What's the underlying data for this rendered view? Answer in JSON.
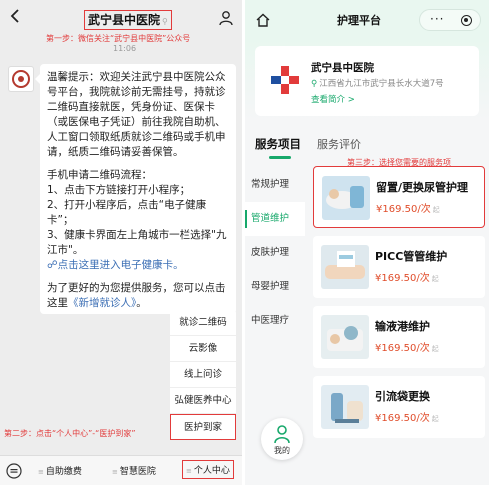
{
  "left": {
    "title": "武宁县中医院",
    "step1": "第一步：微信关注“武宁县中医院”公众号",
    "time": "11:06",
    "message": {
      "para1": "温馨提示：欢迎关注武宁县中医院公众号平台，我院就诊前无需挂号，持就诊二维码直接就医，凭身份证、医保卡（或医保电子凭证）前往我院自助机、人工窗口领取纸质就诊二维码或手机申请，纸质二维码请妥善保管。",
      "para2_head": "手机申请二维码流程：",
      "step_a": "1、点击下方链接打开小程序；",
      "step_b": "2、打开小程序后，点击“电子健康卡”；",
      "step_c": "3、健康卡界面左上角城市一栏选择\"九江市\"。",
      "link1": "点击这里进入电子健康卡。",
      "para3_text": "为了更好的为您提供服务，您可以点击这里",
      "link2": "《新增就诊人》",
      "para3_end": "。"
    },
    "menu": [
      "就诊二维码",
      "云影像",
      "线上问诊",
      "弘健医养中心",
      "医护到家"
    ],
    "step2": "第二步：点击“个人中心”-“医护到家”",
    "bottom": [
      "自助缴费",
      "智慧医院",
      "个人中心"
    ]
  },
  "right": {
    "title": "护理平台",
    "hospital": {
      "name": "武宁县中医院",
      "address": "江西省九江市武宁县长水大道7号",
      "more": "查看简介 >"
    },
    "tabs": [
      "服务项目",
      "服务评价"
    ],
    "step3": "第三步：选择您需要的服务项",
    "categories": [
      "常规护理",
      "管道维护",
      "皮肤护理",
      "母婴护理",
      "中医理疗"
    ],
    "mine": "我的",
    "services": [
      {
        "name": "留置/更换尿管护理",
        "price": "¥169.50/次",
        "from": "起"
      },
      {
        "name": "PICC管管维护",
        "price": "¥169.50/次",
        "from": "起"
      },
      {
        "name": "输液港维护",
        "price": "¥169.50/次",
        "from": "起"
      },
      {
        "name": "引流袋更换",
        "price": "¥169.50/次",
        "from": "起"
      }
    ]
  },
  "colors": {
    "accent_green": "#17a86b",
    "annotation_red": "#e23b3b",
    "price_orange": "#e04d2b"
  }
}
